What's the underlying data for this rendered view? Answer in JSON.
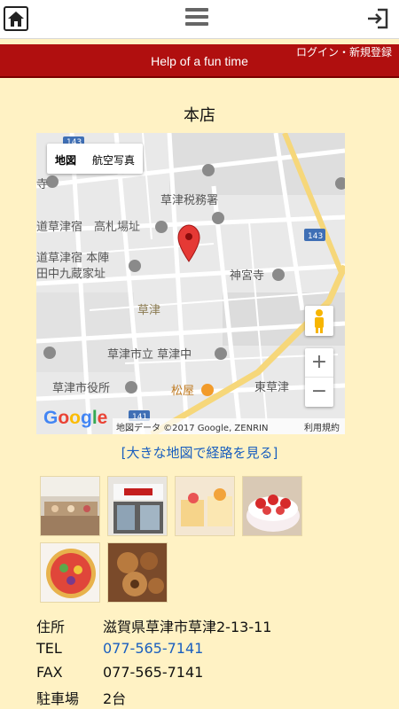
{
  "header": {
    "home": "home-icon",
    "menu": "hamburger-menu-icon",
    "login": "login-icon"
  },
  "banner": {
    "title": "Help of a fun time",
    "login_link": "ログイン・新規登録"
  },
  "store": {
    "title": "本店"
  },
  "map": {
    "type_map": "地図",
    "type_satellite": "航空写真",
    "zoom_in": "+",
    "zoom_out": "−",
    "logo": "Google",
    "attribution": "地図データ ©2017 Google, ZENRIN",
    "terms": "利用規約",
    "labels": {
      "tax_office": "草津税務署",
      "takafuda": "高札場址",
      "kusatsu_juku": "道草津宿",
      "honjin": "道草津宿 本陣",
      "tanaka": "田中九蔵家址",
      "shinguji": "神宮寺",
      "kusatsu": "草津",
      "junior_high": "草津市立 草津中",
      "city_hall": "草津市役所",
      "matsuya": "松屋",
      "higashi_kusatsu": "東草津",
      "road_143a": "143",
      "road_143b": "143",
      "road_141": "141",
      "temple_left": "寺"
    }
  },
  "map_link": "[大きな地図で経路を見る]",
  "info": {
    "address_label": "住所",
    "address_value": "滋賀県草津市草津2-13-11",
    "tel_label": "TEL",
    "tel_value": "077-565-7141",
    "fax_label": "FAX",
    "fax_value": "077-565-7141",
    "parking_label": "駐車場",
    "parking_value": "2台"
  },
  "colors": {
    "banner": "#b00f0f",
    "background": "#fff2c4",
    "link": "#1a5fbf",
    "pin": "#e53935"
  }
}
